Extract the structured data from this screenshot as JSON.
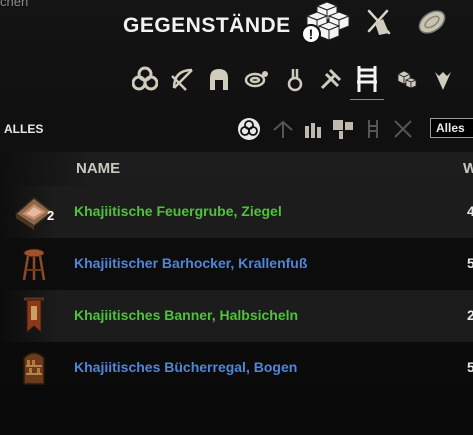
{
  "corner_text": "chen",
  "title": "GEGENSTÄNDE",
  "filter_label": "ALLES",
  "dropdown_value": "Alles",
  "columns": {
    "name": "NAME",
    "value": "W"
  },
  "alert_symbol": "!",
  "items": [
    {
      "count": "2",
      "name": "Khajiitische Feuergrube, Ziegel",
      "quality": "green",
      "value": "4",
      "icon": "fire-pit-icon"
    },
    {
      "count": "",
      "name": "Khajiitischer Barhocker, Krallenfuß",
      "quality": "blue",
      "value": "5",
      "icon": "bar-stool-icon"
    },
    {
      "count": "",
      "name": "Khajiitisches Banner, Halbsicheln",
      "quality": "green",
      "value": "2",
      "icon": "banner-icon"
    },
    {
      "count": "",
      "name": "Khajiitisches Bücherregal, Bogen",
      "quality": "blue",
      "value": "5",
      "icon": "bookshelf-icon"
    }
  ],
  "colors": {
    "green": "#4ec33a",
    "blue": "#4f86d8"
  }
}
